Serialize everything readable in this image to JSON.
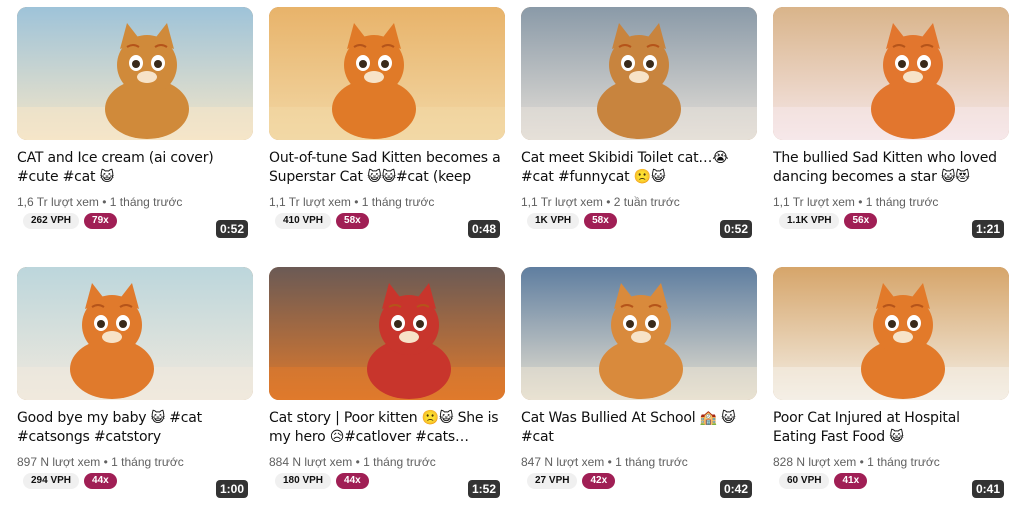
{
  "videos": [
    {
      "title": "CAT and Ice cream (ai cover) #cute #cat 😺",
      "duration": "0:52",
      "views": "1,6 Tr lượt xem",
      "age": "1 tháng trước",
      "vph": "262 VPH",
      "multiplier": "79x",
      "colors": [
        "#9ec3d9",
        "#d08a3a",
        "#f5e6c8"
      ]
    },
    {
      "title": "Out-of-tune Sad Kitten becomes a Superstar Cat 😺😺#cat (keep yo…",
      "duration": "0:48",
      "views": "1,1 Tr lượt xem",
      "age": "1 tháng trước",
      "vph": "410 VPH",
      "multiplier": "58x",
      "colors": [
        "#e8b36a",
        "#e07a28",
        "#f2d8a6"
      ]
    },
    {
      "title": "Cat meet Skibidi Toilet cat…😭 #cat #funnycat 🙁😺 #catmemes",
      "duration": "0:52",
      "views": "1,1 Tr lượt xem",
      "age": "2 tuần trước",
      "vph": "1K VPH",
      "multiplier": "58x",
      "colors": [
        "#8a9aa8",
        "#c8843e",
        "#e6e0d8"
      ]
    },
    {
      "title": "The bullied Sad Kitten who loved dancing becomes a star 😺😻#ca…",
      "duration": "1:21",
      "views": "1,1 Tr lượt xem",
      "age": "1 tháng trước",
      "vph": "1.1K VPH",
      "multiplier": "56x",
      "colors": [
        "#d9b48a",
        "#e2762e",
        "#f6e8ea"
      ]
    },
    {
      "title": "Good bye my baby 😺 #cat #catsongs #catstory",
      "duration": "1:00",
      "views": "897 N lượt xem",
      "age": "1 tháng trước",
      "vph": "294 VPH",
      "multiplier": "44x",
      "colors": [
        "#bcd6dc",
        "#e07a2c",
        "#f1e9dd"
      ]
    },
    {
      "title": "Cat story | Poor kitten 🙁😺 She is my hero 😥#catlover #cats…",
      "duration": "1:52",
      "views": "884 N lượt xem",
      "age": "1 tháng trước",
      "vph": "180 VPH",
      "multiplier": "44x",
      "colors": [
        "#6b5a55",
        "#c8352c",
        "#e07a2c"
      ]
    },
    {
      "title": "Cat Was Bullied At School 🏫 😺 #cat",
      "duration": "0:42",
      "views": "847 N lượt xem",
      "age": "1 tháng trước",
      "vph": "27 VPH",
      "multiplier": "42x",
      "colors": [
        "#5f7ea0",
        "#d98a3c",
        "#e9e2d2"
      ]
    },
    {
      "title": "Poor Cat Injured at Hospital Eating Fast Food 😺",
      "duration": "0:41",
      "views": "828 N lượt xem",
      "age": "1 tháng trước",
      "vph": "60 VPH",
      "multiplier": "41x",
      "colors": [
        "#d6a56a",
        "#e27a2a",
        "#f4efe6"
      ]
    }
  ]
}
